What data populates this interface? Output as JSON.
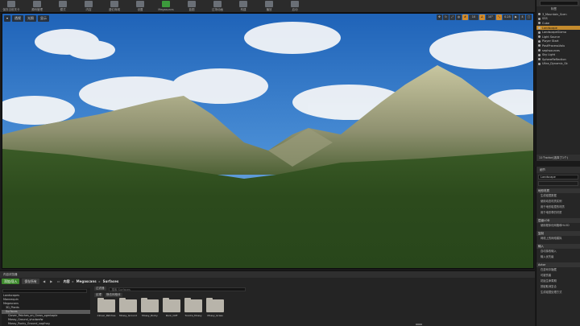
{
  "toolbar": {
    "buttons": [
      {
        "label": "保存当前关卡",
        "icon": "save-icon"
      },
      {
        "label": "源码管理",
        "icon": "source-control-icon"
      },
      {
        "label": "模式",
        "icon": "modes-icon"
      },
      {
        "label": "内容",
        "icon": "content-icon"
      },
      {
        "label": "虚幻商城",
        "icon": "marketplace-icon"
      },
      {
        "label": "设置",
        "icon": "settings-icon"
      },
      {
        "label": "Megascans",
        "icon": "megascans-icon",
        "accent": "#3c9a3c"
      },
      {
        "label": "蓝图",
        "icon": "blueprints-icon"
      },
      {
        "label": "过场动画",
        "icon": "cinematics-icon"
      },
      {
        "label": "构建",
        "icon": "build-icon"
      },
      {
        "label": "播放",
        "icon": "play-icon"
      },
      {
        "label": "启动",
        "icon": "launch-icon"
      }
    ]
  },
  "viewport": {
    "view_button": "透视",
    "lit_button": "光照",
    "show_button": "显示",
    "snap_value": "10",
    "rot_value": "10°",
    "scale_value": "0.25",
    "cam_speed": "4",
    "accent": "#d28a2a"
  },
  "outliner": {
    "title": "标签",
    "items": [
      {
        "label": "3_Mountain_Scen",
        "selected": false
      },
      {
        "label": "SSS",
        "selected": false
      },
      {
        "label": "Cube",
        "selected": false
      },
      {
        "label": "Landscape",
        "selected": true
      },
      {
        "label": "LandscapeGizmo",
        "selected": false
      },
      {
        "label": "Light Source",
        "selected": false
      },
      {
        "label": "Player Start",
        "selected": false
      },
      {
        "label": "PostProcessVolu",
        "selected": false
      },
      {
        "label": "sephsources",
        "selected": false
      },
      {
        "label": "Sky Light",
        "selected": false
      },
      {
        "label": "SphereReflection",
        "selected": false
      },
      {
        "label": "Ultra_Dynamic_Sk",
        "selected": false
      }
    ],
    "status": "11个actor(选择了1个)",
    "selection_color": "#c48b2d"
  },
  "details": {
    "tab": "细节",
    "actor_name": "Landscape",
    "sections": [
      {
        "title": "地形材质",
        "items": [
          "生成碰撞数据",
          "使用动态材质实例",
          "用于地形碰撞的材质",
          "用于地形草的材质"
        ]
      },
      {
        "title": "层级LOD",
        "items": [
          "使用程序化网格和HLOD"
        ]
      },
      {
        "title": "复制",
        "items": [
          "网络上的网络模拟"
        ]
      },
      {
        "title": "输入",
        "items": [
          "自动接收输入",
          "输入优先级"
        ]
      },
      {
        "title": "Actor",
        "items": [
          "在游戏中隐藏",
          "可被伤害",
          "初始生命周期",
          "按键取消复合",
          "生成碰撞处理方式"
        ]
      }
    ]
  },
  "content_browser": {
    "tab": "内容浏览器",
    "add_button": "添加/导入",
    "save_button": "保存所有",
    "breadcrumbs": [
      "内容",
      "Megascans",
      "Surfaces"
    ],
    "filters_button": "过滤器",
    "search_placeholder": "搜索 Surfaces",
    "filter_chips": [
      "纹理",
      "静态网格体"
    ],
    "tree": [
      {
        "label": "Landscapes",
        "selected": false
      },
      {
        "label": "Mannequin",
        "selected": false
      },
      {
        "label": "Megascans",
        "selected": false
      },
      {
        "label": "3D_Plants",
        "selected": false
      },
      {
        "label": "Surfaces",
        "selected": true
      },
      {
        "label": "Clover_Patches_on_Grass_ogmkaple",
        "selected": false
      },
      {
        "label": "Mossy_Ground_vhxdwxfw",
        "selected": false
      },
      {
        "label": "Mossy_Rocky_Ground_vogfnzg",
        "selected": false
      }
    ],
    "folders": [
      "Clover_Patches",
      "Mossy_Ground",
      "Mossy_Rocky",
      "Rock_Cliff",
      "Tundra_Mossy",
      "Mossy_Grass"
    ],
    "add_color": "#3f8a2e"
  }
}
